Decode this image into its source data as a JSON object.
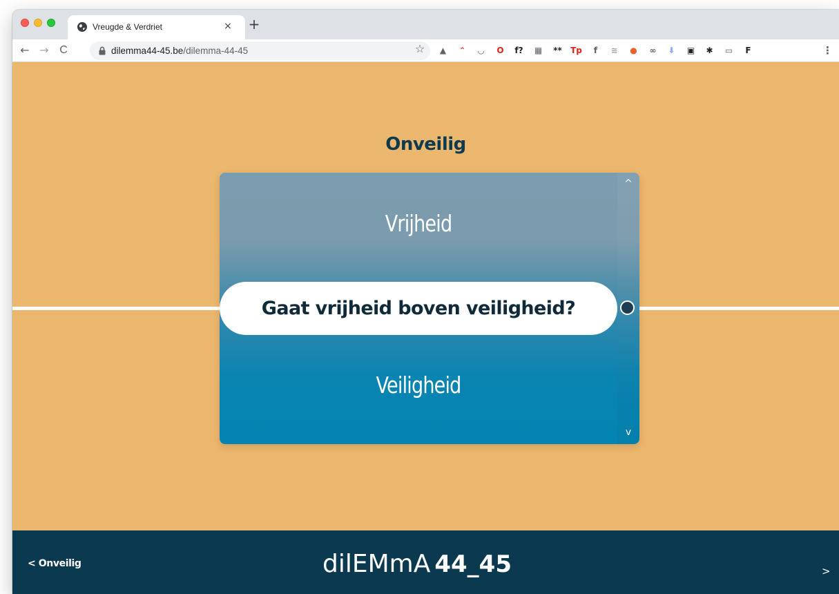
{
  "browser": {
    "tab_title": "Vreugde & Verdriet",
    "tab_close": "×",
    "new_tab": "+",
    "url_host": "dilemma44-45.be",
    "url_path": "/dilemma-44-45",
    "back": "←",
    "forward": "→",
    "reload": "C",
    "star": "☆",
    "menu": "⋮",
    "extensions": [
      {
        "name": "drive-icon",
        "glyph": "▲",
        "color": "#5f6368"
      },
      {
        "name": "rainbow-icon",
        "glyph": "⌃",
        "color": "#e8453c"
      },
      {
        "name": "pocket-icon",
        "glyph": "◡",
        "color": "#5f6368"
      },
      {
        "name": "opera-icon",
        "glyph": "O",
        "color": "#e5231e"
      },
      {
        "name": "font-finder-icon",
        "glyph": "f?",
        "color": "#202124"
      },
      {
        "name": "media-icon",
        "glyph": "▦",
        "color": "#5f6368"
      },
      {
        "name": "password-icon",
        "glyph": "**",
        "color": "#202124"
      },
      {
        "name": "tp-icon",
        "glyph": "Tp",
        "color": "#e5231e"
      },
      {
        "name": "facebook-icon",
        "glyph": "f",
        "color": "#5f6368"
      },
      {
        "name": "wifi-icon",
        "glyph": "≋",
        "color": "#a0a4a8"
      },
      {
        "name": "fire-icon",
        "glyph": "●",
        "color": "#e8632a"
      },
      {
        "name": "link-icon",
        "glyph": "∞",
        "color": "#5f6368"
      },
      {
        "name": "download-icon",
        "glyph": "⬇",
        "color": "#8ab4f8"
      },
      {
        "name": "sidebar-icon",
        "glyph": "▣",
        "color": "#202124"
      },
      {
        "name": "puzzle-icon",
        "glyph": "✱",
        "color": "#202124"
      },
      {
        "name": "cast-icon",
        "glyph": "▭",
        "color": "#5f6368"
      },
      {
        "name": "profile-f-icon",
        "glyph": "F",
        "color": "#202124"
      }
    ]
  },
  "page": {
    "title": "Onveilig",
    "option_top": "Vrijheid",
    "question": "Gaat vrijheid boven veiligheid?",
    "option_bottom": "Veiligheid",
    "scroll_up": "^",
    "scroll_down": "v"
  },
  "footer": {
    "prev_label": "< Onveilig",
    "logo_text": "dilEMmA",
    "logo_number": "44_45",
    "next_label": ">"
  },
  "colors": {
    "background": "#ebb66d",
    "title": "#0e3a4f",
    "footer": "#0b3a50"
  }
}
